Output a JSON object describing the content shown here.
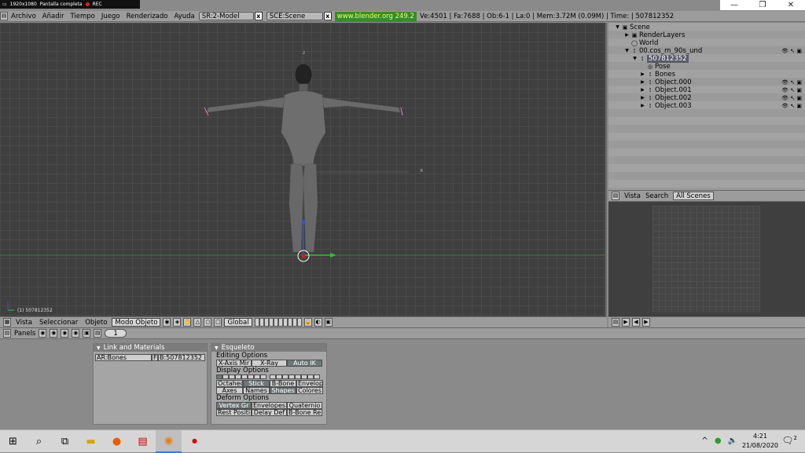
{
  "recbar": {
    "resolution": "1920x1080",
    "mode": "Pantalla completa",
    "rec": "REC"
  },
  "window": {
    "minimize": "—",
    "maximize": "❐",
    "close": "✕"
  },
  "topbar": {
    "menus": [
      "Archivo",
      "Añadir",
      "Tiempo",
      "Juego",
      "Renderizado",
      "Ayuda"
    ],
    "screen": "SR:2-Model",
    "scene": "SCE:Scene",
    "url": "www.blender.org 249.2",
    "stats": "Ve:4501 | Fa:7688 | Ob:6-1 | La:0  | Mem:3.72M (0.09M)  | Time: | 507812352"
  },
  "viewport": {
    "label": "(1) 507812352",
    "x_axis": "x",
    "z_axis": "z"
  },
  "outliner": {
    "rows": [
      {
        "label": "Scene",
        "indent": 0,
        "tri": "▼",
        "icon": "▣"
      },
      {
        "label": "RenderLayers",
        "indent": 1,
        "tri": "▶",
        "icon": "▣"
      },
      {
        "label": "World",
        "indent": 1,
        "tri": "",
        "icon": "◯"
      },
      {
        "label": "00.cos_m_90s_und",
        "indent": 1,
        "tri": "▼",
        "icon": "⟟"
      },
      {
        "label": "507812352",
        "indent": 2,
        "tri": "▼",
        "icon": "⟟",
        "selected": true
      },
      {
        "label": "Pose",
        "indent": 3,
        "tri": "",
        "icon": "◎"
      },
      {
        "label": "Bones",
        "indent": 3,
        "tri": "▶",
        "icon": "⟟"
      },
      {
        "label": "Object.000",
        "indent": 3,
        "tri": "▶",
        "icon": "⟟"
      },
      {
        "label": "Object.001",
        "indent": 3,
        "tri": "▶",
        "icon": "⟟"
      },
      {
        "label": "Object.002",
        "indent": 3,
        "tri": "▶",
        "icon": "⟟"
      },
      {
        "label": "Object.003",
        "indent": 3,
        "tri": "▶",
        "icon": "⟟"
      }
    ]
  },
  "outliner_header": {
    "view": "Vista",
    "search": "Search",
    "filter": "All Scenes"
  },
  "view_header": {
    "view": "Vista",
    "select": "Seleccionar",
    "object": "Objeto",
    "mode": "Modo Objeto",
    "pivot": "Global"
  },
  "buttons_header": {
    "panels": "Panels",
    "frame": "1"
  },
  "link_panel": {
    "title": "Link and Materials",
    "armature": "AR:Bones",
    "fake": "F",
    "bone": "B:507812352"
  },
  "skeleton_panel": {
    "title": "Esqueleto",
    "editing": "Editing Options",
    "editing_buttons": [
      "X-Axis Mir",
      "X-Ray",
      "Auto IK"
    ],
    "display": "Display Options",
    "display_row1": [
      "Octahedr",
      "Stick",
      "B-Bone",
      "Envelop"
    ],
    "display_row2": [
      "Axes",
      "Names",
      "Shapes",
      "Colores"
    ],
    "deform": "Deform Options",
    "deform_row1": [
      "Vertex Gr",
      "Envelopes",
      "Quaternio"
    ],
    "deform_row2": [
      "Rest Positi",
      "Delay Def",
      "B-Bone Re"
    ]
  },
  "taskbar": {
    "time": "4:21",
    "date": "21/08/2020",
    "notifications": "2"
  }
}
